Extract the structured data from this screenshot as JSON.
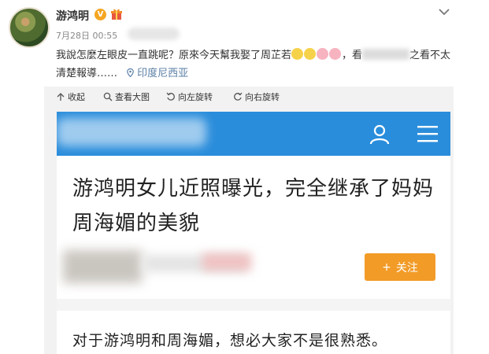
{
  "post": {
    "username": "游鸿明",
    "verified_badge": "V",
    "date": "7月28日 00:55",
    "text_part1": "我說怎麼左眼皮一直跳呢？原來今天幫我娶了周芷若",
    "text_part2": "，看",
    "text_part3": "之看不太清楚報導……",
    "location": "印度尼西亚"
  },
  "toolbar": {
    "collapse": "收起",
    "view_large": "查看大图",
    "rotate_left": "向左旋转",
    "rotate_right": "向右旋转"
  },
  "article": {
    "headline": "游鸿明女儿近照曝光，完全继承了妈妈周海媚的美貌",
    "follow_button": "关注",
    "follow_plus": "+",
    "body_first_line": "对于游鸿明和周海媚，想必大家不是很熟悉。"
  },
  "colors": {
    "header_blue": "#2a8ddb",
    "follow_orange": "#f29b27",
    "badge_orange": "#f5a623",
    "location_blue": "#5b7fa6"
  },
  "icons": [
    "gift-icon",
    "chevron-down-icon",
    "location-pin-icon",
    "collapse-icon",
    "zoom-icon",
    "rotate-left-icon",
    "rotate-right-icon",
    "user-icon",
    "menu-icon"
  ]
}
